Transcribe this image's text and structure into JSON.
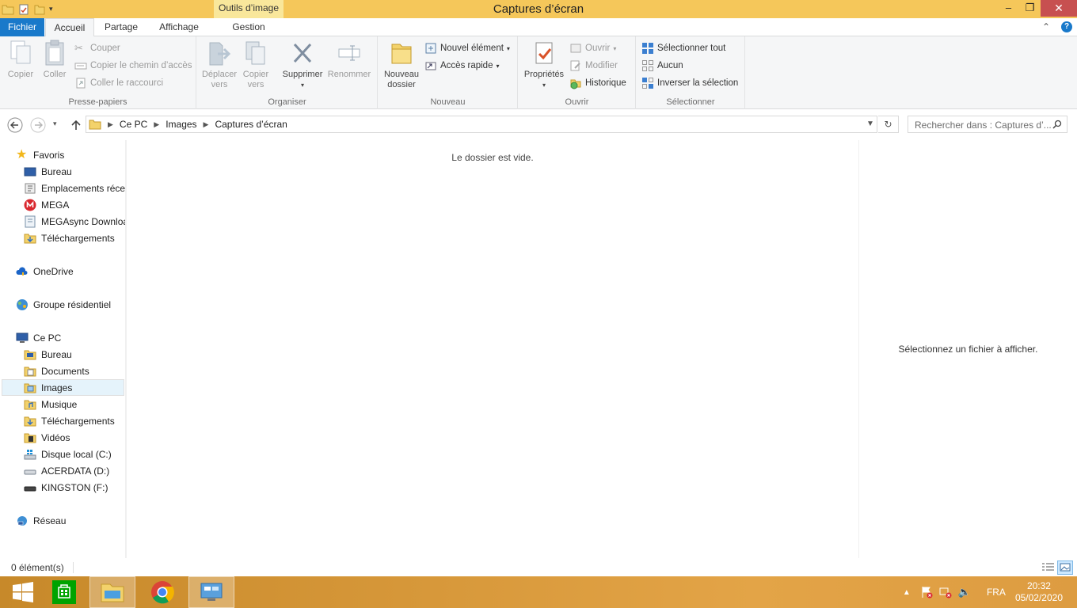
{
  "window": {
    "title": "Captures d’écran",
    "context_tab": "Outils d’image"
  },
  "tabs": {
    "file": "Fichier",
    "home": "Accueil",
    "share": "Partage",
    "view": "Affichage",
    "manage": "Gestion"
  },
  "ribbon": {
    "clipboard": {
      "label": "Presse-papiers",
      "copy": "Copier",
      "paste": "Coller",
      "cut": "Couper",
      "copy_path": "Copier le chemin d’accès",
      "paste_shortcut": "Coller le raccourci"
    },
    "organize": {
      "label": "Organiser",
      "move_to_1": "Déplacer",
      "move_to_2": "vers",
      "copy_to_1": "Copier",
      "copy_to_2": "vers",
      "delete": "Supprimer",
      "rename": "Renommer"
    },
    "new": {
      "label": "Nouveau",
      "new_folder_1": "Nouveau",
      "new_folder_2": "dossier",
      "new_item": "Nouvel élément",
      "easy_access": "Accès rapide"
    },
    "open": {
      "label": "Ouvrir",
      "properties": "Propriétés",
      "open": "Ouvrir",
      "edit": "Modifier",
      "history": "Historique"
    },
    "select": {
      "label": "Sélectionner",
      "select_all": "Sélectionner tout",
      "select_none": "Aucun",
      "invert": "Inverser la sélection"
    }
  },
  "address": {
    "crumbs": [
      "Ce PC",
      "Images",
      "Captures d’écran"
    ],
    "search_placeholder": "Rechercher dans : Captures d’..."
  },
  "nav": {
    "favorites": "Favoris",
    "fav_items": [
      "Bureau",
      "Emplacements récents",
      "MEGA",
      "MEGAsync Downloads",
      "Téléchargements"
    ],
    "onedrive": "OneDrive",
    "homegroup": "Groupe résidentiel",
    "thispc": "Ce PC",
    "pc_items": [
      "Bureau",
      "Documents",
      "Images",
      "Musique",
      "Téléchargements",
      "Vidéos",
      "Disque local (C:)",
      "ACERDATA (D:)",
      "KINGSTON (F:)"
    ],
    "network": "Réseau"
  },
  "content": {
    "empty_msg": "Le dossier est vide.",
    "preview_msg": "Sélectionnez un fichier à afficher."
  },
  "status": {
    "count": "0 élément(s)"
  },
  "taskbar": {
    "lang": "FRA",
    "time": "20:32",
    "date": "05/02/2020"
  },
  "colors": {
    "title_bar": "#f5c75a",
    "file_tab": "#1979ca",
    "taskbar": "#d7983a"
  }
}
